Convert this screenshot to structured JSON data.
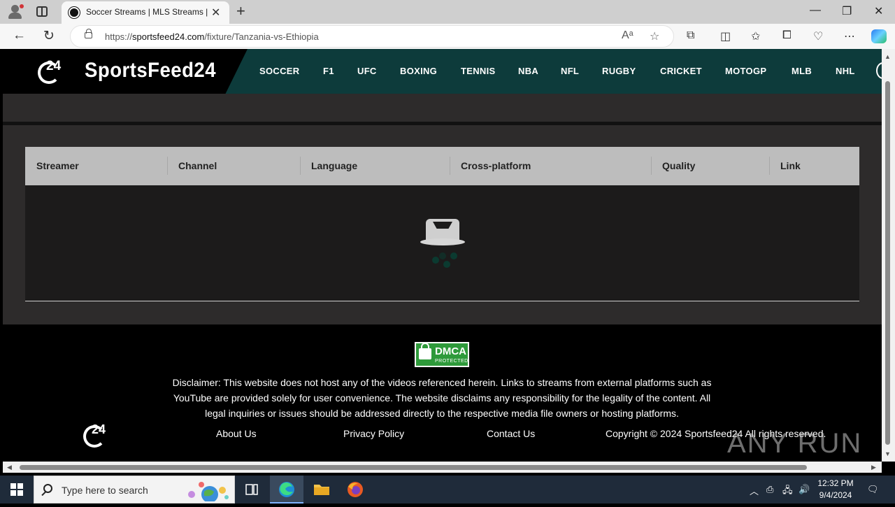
{
  "browser": {
    "tab_title": "Soccer Streams | MLS Streams | N",
    "url_scheme": "https://",
    "url_host": "sportsfeed24.com",
    "url_path": "/fixture/Tanzania-vs-Ethiopia"
  },
  "site": {
    "logo_badge": "24",
    "logo_text": "SportsFeed24",
    "nav": [
      "SOCCER",
      "F1",
      "UFC",
      "BOXING",
      "TENNIS",
      "NBA",
      "NFL",
      "RUGBY",
      "CRICKET",
      "MOTOGP",
      "MLB",
      "NHL"
    ]
  },
  "table": {
    "headers": [
      "Streamer",
      "Channel",
      "Language",
      "Cross-platform",
      "Quality",
      "Link"
    ]
  },
  "footer": {
    "dmca_title": "DMCA",
    "dmca_sub": "PROTECTED",
    "disclaimer": "Disclaimer: This website does not host any of the videos referenced herein. Links to streams from external platforms such as YouTube are provided solely for user convenience. The website disclaims any responsibility for the legality of the content. All legal inquiries or issues should be addressed directly to the respective media file owners or hosting platforms.",
    "badge": "24",
    "links": [
      "About Us",
      "Privacy Policy",
      "Contact Us"
    ],
    "copyright": "Copyright © 2024 Sportsfeed24 All rights reserved."
  },
  "watermark": "ANY RUN",
  "taskbar": {
    "search_placeholder": "Type here to search",
    "time": "12:32 PM",
    "date": "9/4/2024"
  },
  "colors": {
    "header_teal": "#0d3b3b",
    "dmca_green": "#2e9a3a",
    "table_head": "#bdbdbd"
  }
}
